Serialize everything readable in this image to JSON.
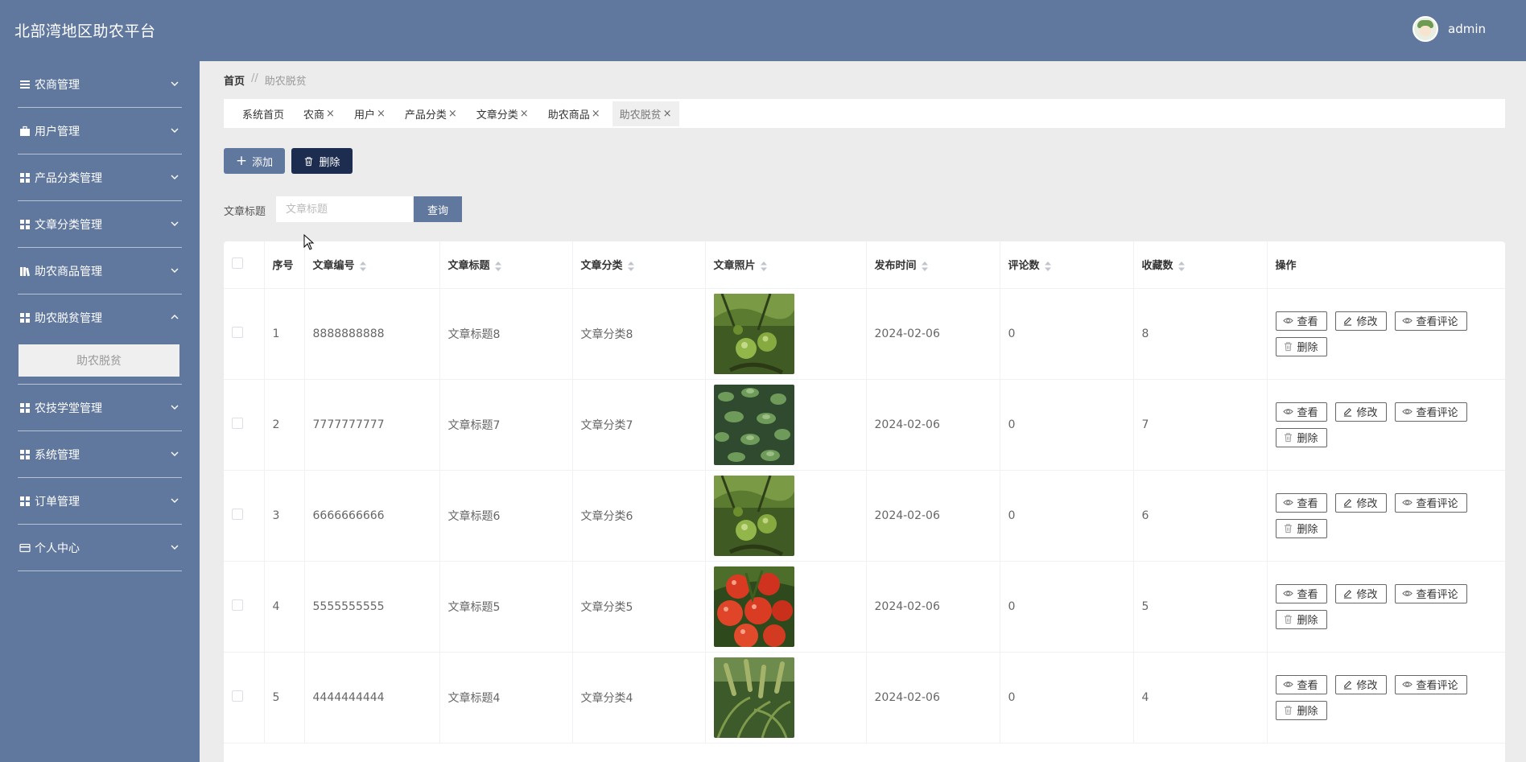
{
  "app": {
    "title": "北部湾地区助农平台",
    "user": "admin"
  },
  "sidebar": {
    "items": [
      {
        "label": "农商管理",
        "icon": "list-icon"
      },
      {
        "label": "用户管理",
        "icon": "briefcase-icon"
      },
      {
        "label": "产品分类管理",
        "icon": "grid-icon"
      },
      {
        "label": "文章分类管理",
        "icon": "grid-icon"
      },
      {
        "label": "助农商品管理",
        "icon": "books-icon"
      },
      {
        "label": "助农脱贫管理",
        "icon": "grid-icon",
        "expanded": true,
        "children": [
          "助农脱贫"
        ]
      },
      {
        "label": "农技学堂管理",
        "icon": "grid-icon"
      },
      {
        "label": "系统管理",
        "icon": "grid-icon"
      },
      {
        "label": "订单管理",
        "icon": "grid-icon"
      },
      {
        "label": "个人中心",
        "icon": "card-icon"
      }
    ]
  },
  "breadcrumb": {
    "home": "首页",
    "separator": "//",
    "current": "助农脱贫"
  },
  "tabs": [
    {
      "label": "系统首页",
      "closable": false
    },
    {
      "label": "农商",
      "closable": true
    },
    {
      "label": "用户",
      "closable": true
    },
    {
      "label": "产品分类",
      "closable": true
    },
    {
      "label": "文章分类",
      "closable": true
    },
    {
      "label": "助农商品",
      "closable": true
    },
    {
      "label": "助农脱贫",
      "closable": true,
      "active": true
    }
  ],
  "toolbar": {
    "add_label": "添加",
    "delete_label": "删除"
  },
  "search": {
    "label": "文章标题",
    "placeholder": "文章标题",
    "value": "",
    "button_label": "查询"
  },
  "table": {
    "columns": [
      "序号",
      "文章编号",
      "文章标题",
      "文章分类",
      "文章照片",
      "发布时间",
      "评论数",
      "收藏数",
      "操作"
    ],
    "sortable": [
      false,
      true,
      true,
      true,
      true,
      true,
      true,
      true,
      false
    ],
    "row_actions": {
      "view": "查看",
      "edit": "修改",
      "comments": "查看评论",
      "delete": "删除"
    },
    "rows": [
      {
        "index": "1",
        "code": "8888888888",
        "title": "文章标题8",
        "category": "文章分类8",
        "photo": "green-tomatoes-photo",
        "date": "2024-02-06",
        "comments": "0",
        "favorites": "8"
      },
      {
        "index": "2",
        "code": "7777777777",
        "title": "文章标题7",
        "category": "文章分类7",
        "photo": "leafy-field-photo",
        "date": "2024-02-06",
        "comments": "0",
        "favorites": "7"
      },
      {
        "index": "3",
        "code": "6666666666",
        "title": "文章标题6",
        "category": "文章分类6",
        "photo": "green-tomatoes-photo",
        "date": "2024-02-06",
        "comments": "0",
        "favorites": "6"
      },
      {
        "index": "4",
        "code": "5555555555",
        "title": "文章标题5",
        "category": "文章分类5",
        "photo": "red-tomatoes-photo",
        "date": "2024-02-06",
        "comments": "0",
        "favorites": "5"
      },
      {
        "index": "5",
        "code": "4444444444",
        "title": "文章标题4",
        "category": "文章分类4",
        "photo": "millet-field-photo",
        "date": "2024-02-06",
        "comments": "0",
        "favorites": "4"
      }
    ]
  },
  "colors": {
    "primary": "#60779e",
    "dark": "#1d2d4f",
    "background": "#ececec"
  }
}
